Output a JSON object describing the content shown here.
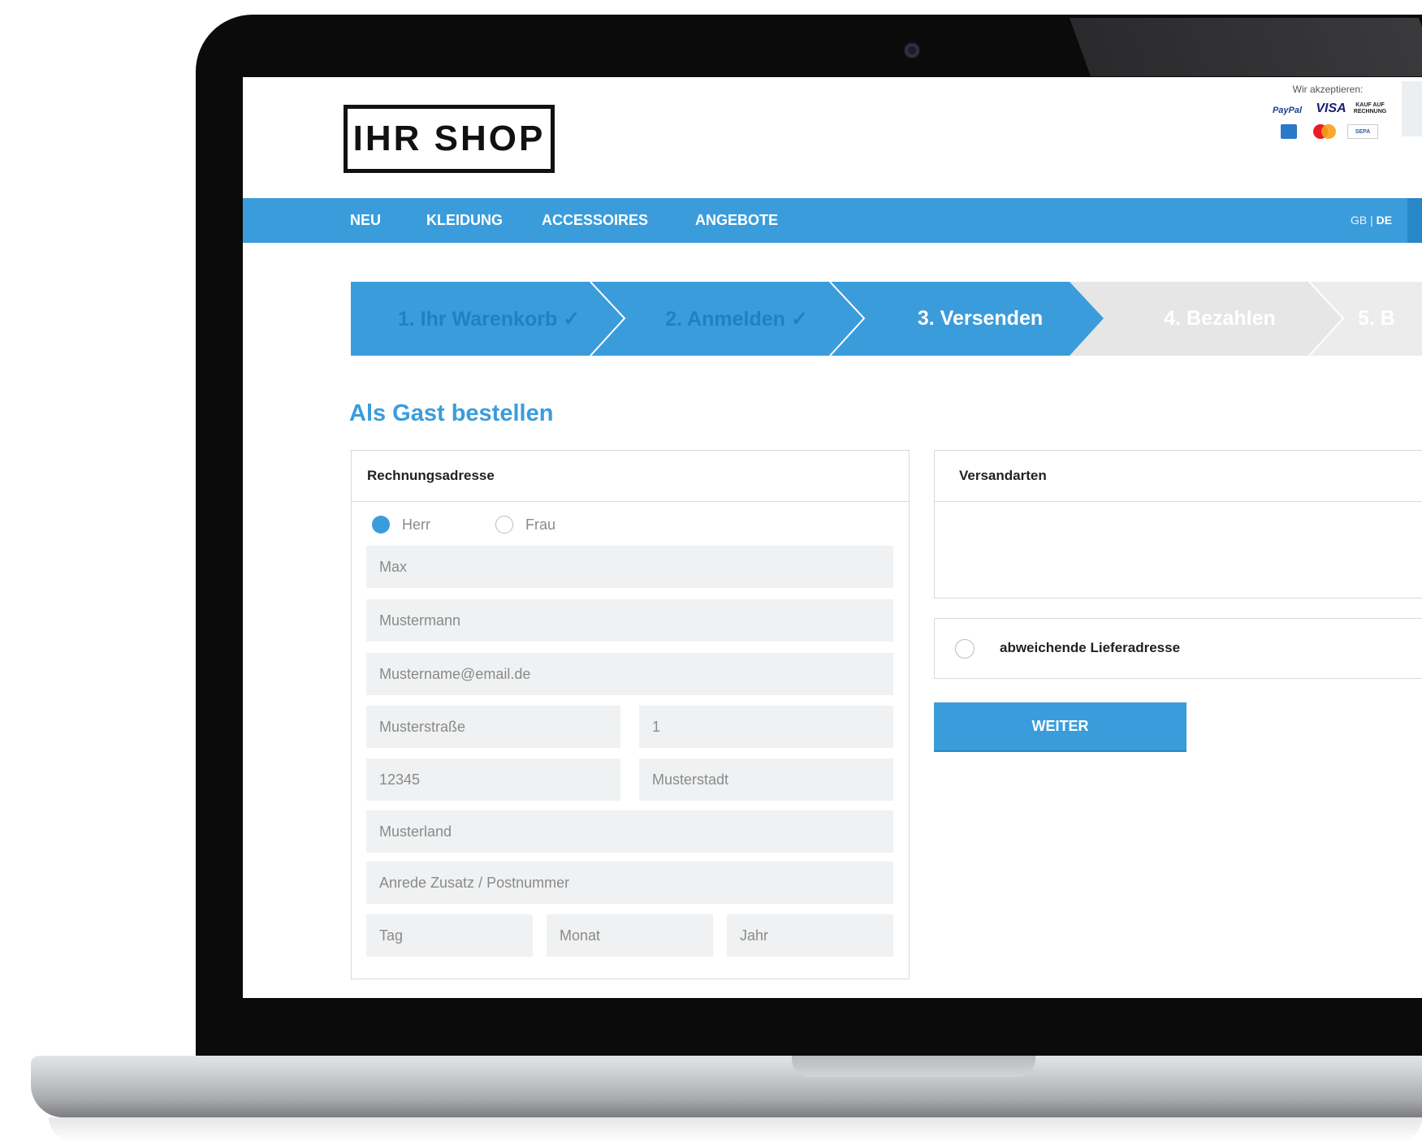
{
  "header": {
    "logo": "IHR SHOP",
    "payment_label": "Wir akzeptieren:",
    "payment_methods": [
      "PayPal",
      "VISA",
      "KAUF AUF RECHNUNG",
      "American Express",
      "Mastercard",
      "SEPA"
    ]
  },
  "nav": {
    "items": [
      {
        "label": "NEU"
      },
      {
        "label": "KLEIDUNG"
      },
      {
        "label": "ACCESSOIRES"
      },
      {
        "label": "ANGEBOTE"
      }
    ],
    "lang_gb": "GB",
    "lang_sep": " | ",
    "lang_de": "DE"
  },
  "steps": [
    {
      "label": "1. Ihr Warenkorb ✓",
      "state": "done"
    },
    {
      "label": "2. Anmelden ✓",
      "state": "done"
    },
    {
      "label": "3. Versenden",
      "state": "active"
    },
    {
      "label": "4. Bezahlen",
      "state": "todo"
    },
    {
      "label": "5. B",
      "state": "todo"
    }
  ],
  "page_heading": "Als Gast bestellen",
  "billing": {
    "title": "Rechnungsadresse",
    "salutation_options": [
      {
        "label": "Herr",
        "selected": true
      },
      {
        "label": "Frau",
        "selected": false
      }
    ],
    "fields": {
      "first_name": "Max",
      "last_name": "Mustermann",
      "email": "Mustername@email.de",
      "street": "Musterstraße",
      "house_number": "1",
      "zip": "12345",
      "city": "Musterstadt",
      "country": "Musterland",
      "extra": "Anrede Zusatz / Postnummer",
      "day": "Tag",
      "month": "Monat",
      "year": "Jahr"
    }
  },
  "shipping": {
    "title": "Versandarten",
    "alt_address_label": "abweichende Lieferadresse",
    "alt_address_checked": false
  },
  "button_next": "WEITER",
  "colors": {
    "accent": "#3b9cdb",
    "step_done_text": "#1f80c4",
    "step_todo_bg": "#e6e6e6",
    "field_bg": "#f0f1f2"
  }
}
